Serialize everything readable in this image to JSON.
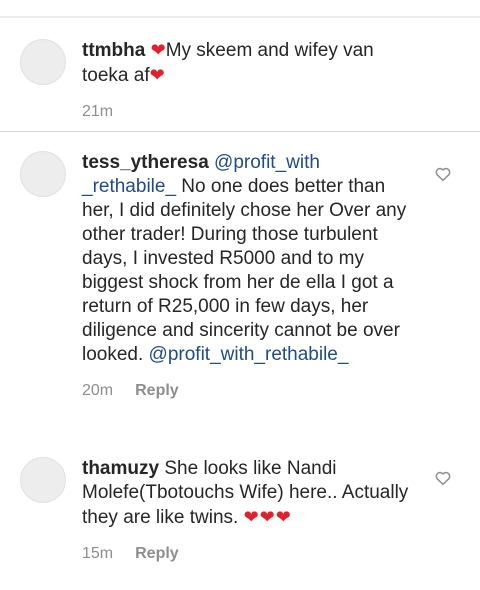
{
  "comments": [
    {
      "username": "ttmbha",
      "text_before": " ",
      "heart1": "❤",
      "text_mid": "My skeem and wifey van toeka af",
      "heart2": "❤",
      "time": "21m"
    },
    {
      "username": "tess_ytheresa",
      "mention1": "@profit_with _rethabile_",
      "text": " No one does better than her, I did definitely chose her Over any other trader!  During those turbulent days, I invested R5000 and to my biggest shock from her de ella I got a return of R25,000 in few days, her diligence and sincerity cannot be over looked. ",
      "mention2": "@profit_with_rethabile_",
      "time": "20m",
      "reply": "Reply"
    },
    {
      "username": "thamuzy",
      "text": " She looks like Nandi Molefe(Tbotouchs Wife) here.. Actually they are like twins. ",
      "hearts": "❤❤❤",
      "time": "15m",
      "reply": "Reply"
    }
  ],
  "icons": {
    "like": "heart-outline-icon",
    "avatar": "avatar-placeholder"
  }
}
